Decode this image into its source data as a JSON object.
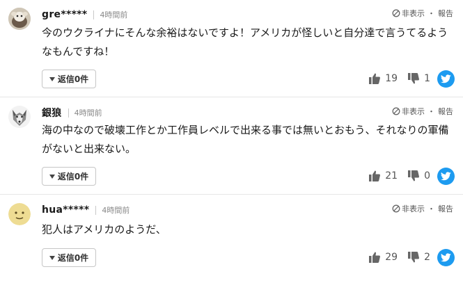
{
  "comments": [
    {
      "username": "gre*****",
      "time": "4時間前",
      "report_hide": "非表示",
      "report_dot": "・",
      "report_label": "報告",
      "text": "今のウクライナにそんな余裕はないですよ！アメリカが怪しいと自分達で言うてるようなもんですね！",
      "reply_label": "返信0件",
      "likes": "19",
      "dislikes": "1",
      "avatar": "sheep-avatar"
    },
    {
      "username": "銀狼",
      "time": "4時間前",
      "report_hide": "非表示",
      "report_dot": "・",
      "report_label": "報告",
      "text": "海の中なので破壊工作とか工作員レベルで出来る事では無いとおもう、それなりの軍備がないと出来ない。",
      "reply_label": "返信0件",
      "likes": "21",
      "dislikes": "0",
      "avatar": "wolf-avatar"
    },
    {
      "username": "hua*****",
      "time": "4時間前",
      "report_hide": "非表示",
      "report_dot": "・",
      "report_label": "報告",
      "text": "犯人はアメリカのようだ、",
      "reply_label": "返信0件",
      "likes": "29",
      "dislikes": "2",
      "avatar": "face-avatar"
    }
  ],
  "colors": {
    "twitter": "#1d9bf0",
    "divider": "#e6e6e6"
  }
}
